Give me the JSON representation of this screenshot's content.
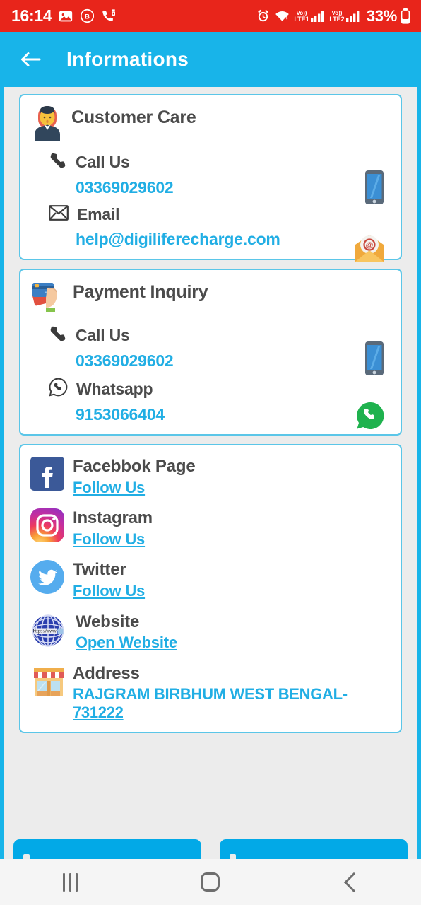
{
  "status_bar": {
    "time": "16:14",
    "battery_percent": "33%",
    "left_icons": [
      "gallery-icon",
      "circled-b-icon",
      "phone-forward-icon"
    ],
    "right_icons": [
      "alarm-icon",
      "wifi-icon",
      "volte1-signal-icon",
      "volte2-signal-icon",
      "battery-icon"
    ],
    "sim1_label": "LTE1",
    "sim2_label": "LTE2",
    "volte_label": "VoLTE",
    "background_color": "#E8251B"
  },
  "app_bar": {
    "title": "Informations",
    "back_icon": "back-arrow-icon",
    "background_color": "#18B4E9"
  },
  "cards": {
    "customer_care": {
      "title": "Customer Care",
      "avatar_icon": "customer-agent-icon",
      "call_label": "Call Us",
      "call_icon": "phone-icon",
      "phone": "03369029602",
      "phone_side_icon": "smartphone-icon",
      "email_label": "Email",
      "email_icon": "envelope-icon",
      "email": "help@digiliferecharge.com",
      "email_side_icon": "email-envelope-icon"
    },
    "payment_inquiry": {
      "title": "Payment Inquiry",
      "card_icon": "credit-card-hand-icon",
      "call_label": "Call Us",
      "call_icon": "phone-icon",
      "phone": "03369029602",
      "phone_side_icon": "smartphone-icon",
      "whatsapp_label": "Whatsapp",
      "whatsapp_icon": "whatsapp-outline-icon",
      "whatsapp_number": "9153066404",
      "whatsapp_side_icon": "whatsapp-color-icon"
    },
    "social": {
      "items": [
        {
          "name": "Facebbok Page",
          "link": "Follow Us",
          "icon": "facebook-icon"
        },
        {
          "name": "Instagram",
          "link": "Follow Us",
          "icon": "instagram-icon"
        },
        {
          "name": "Twitter",
          "link": "Follow Us",
          "icon": "twitter-icon"
        },
        {
          "name": "Website",
          "link": "Open Website",
          "icon": "globe-icon"
        }
      ],
      "address": {
        "name": "Address",
        "icon": "shop-icon",
        "line": "RAJGRAM BIRBHUM WEST BENGAL-",
        "zip": "731222"
      }
    }
  },
  "bottom_buttons": [
    {
      "name": "left-action-button"
    },
    {
      "name": "right-action-button"
    }
  ],
  "nav_bar": {
    "recents_icon": "recents-icon",
    "home_icon": "home-icon",
    "back_icon": "back-icon"
  },
  "colors": {
    "accent": "#18B4E9",
    "link": "#21AEE4",
    "status": "#E8251B",
    "text": "#4B4B4B"
  }
}
